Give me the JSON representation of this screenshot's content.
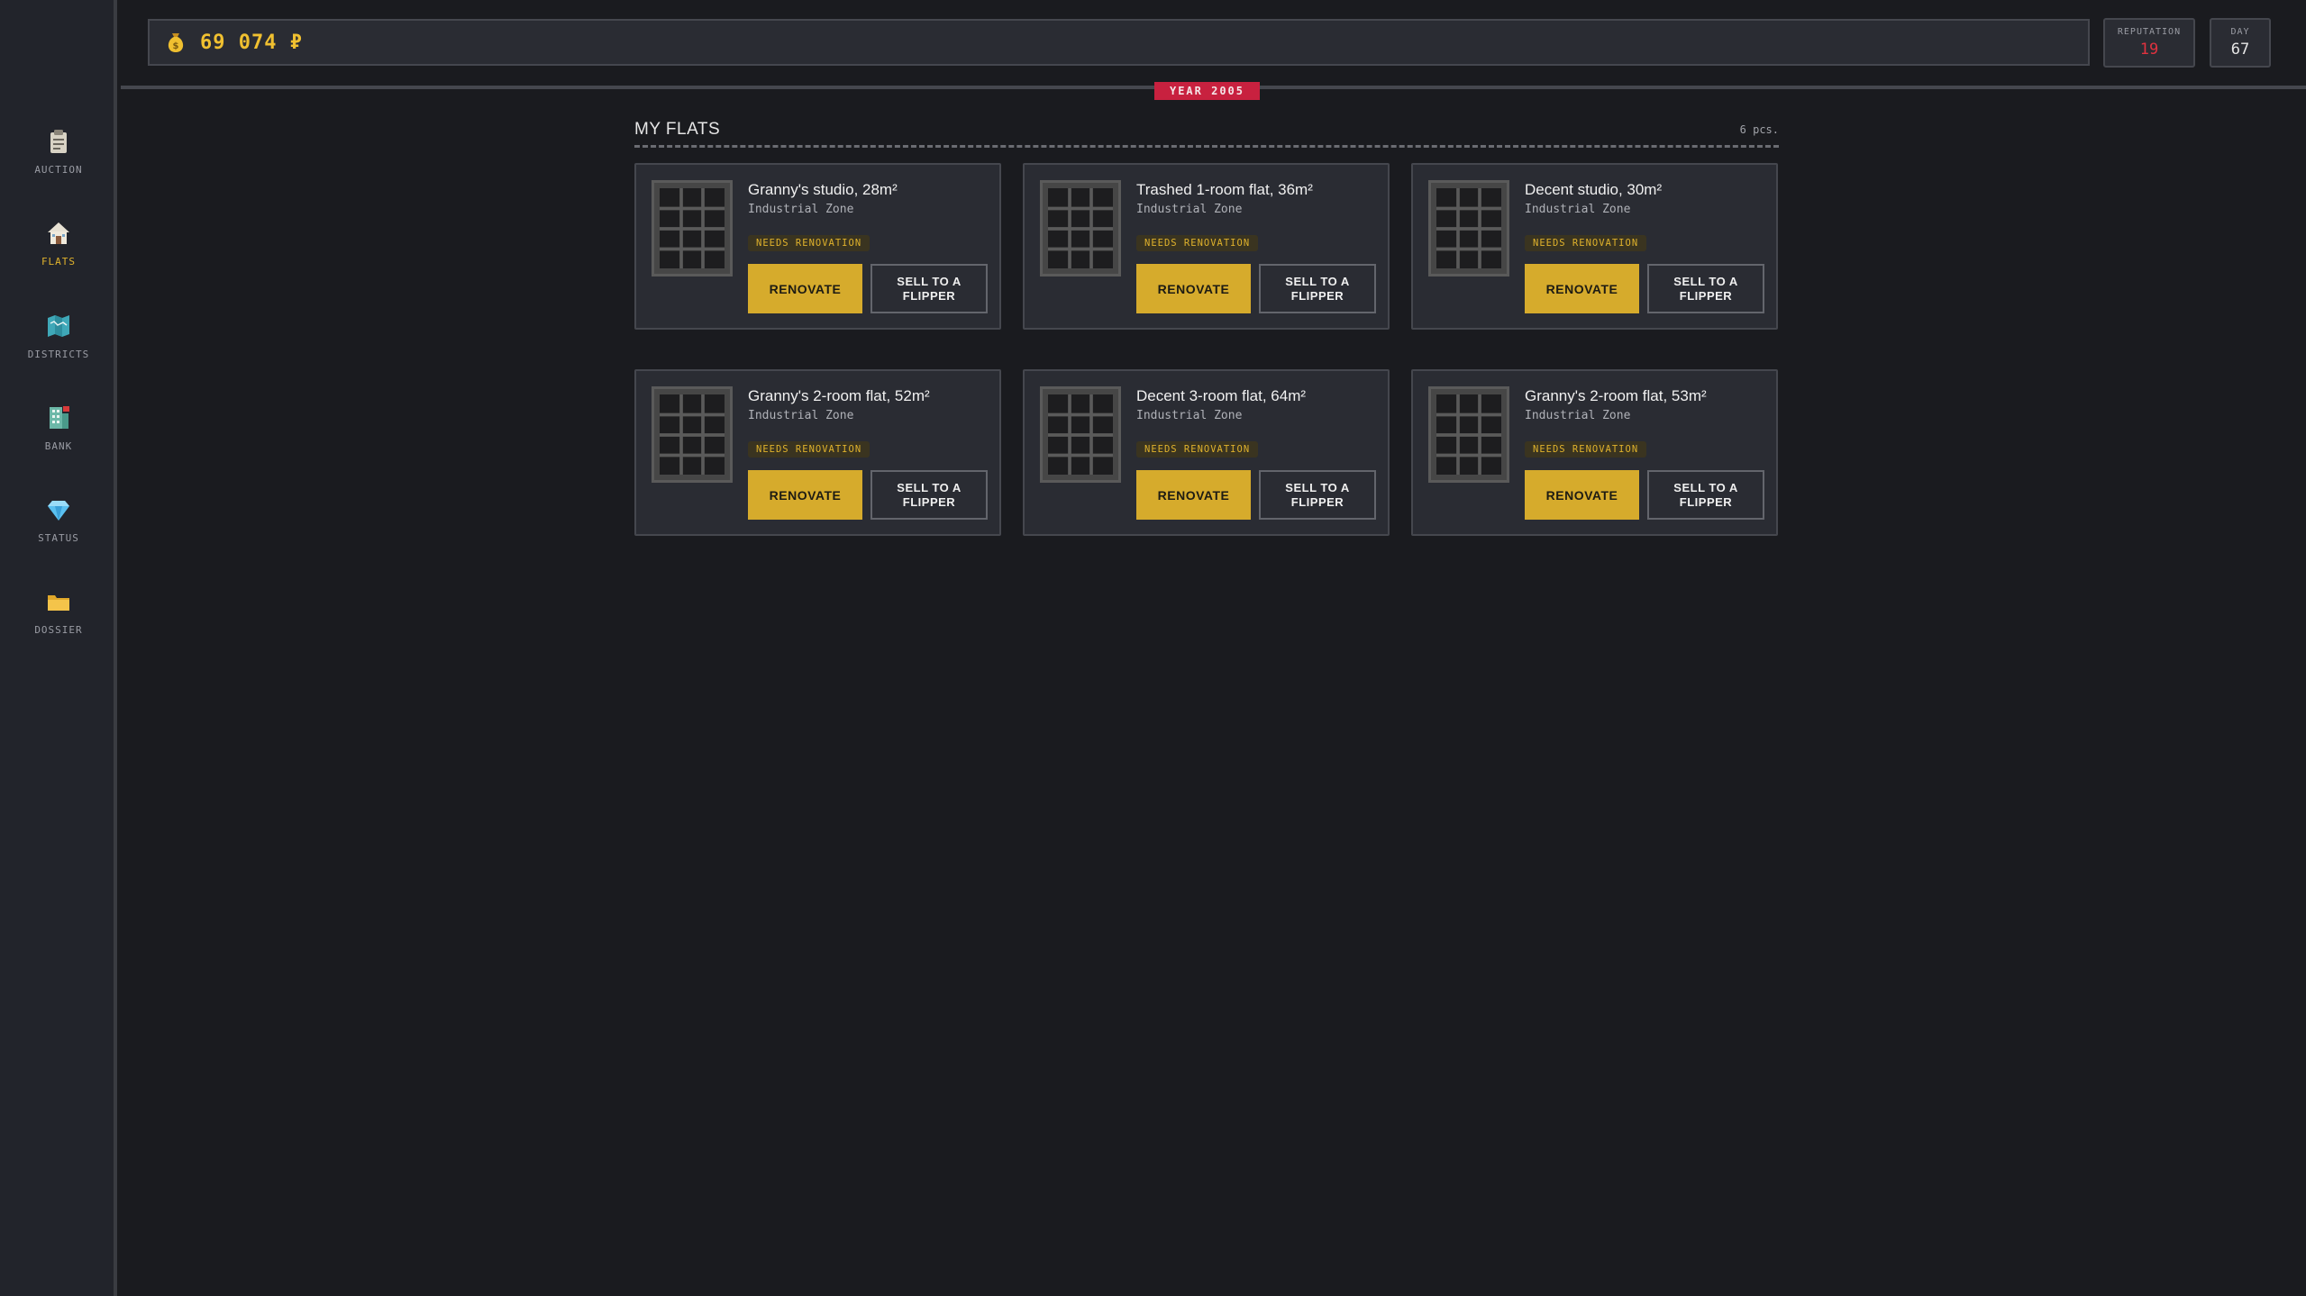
{
  "sidebar": {
    "items": [
      {
        "label": "AUCTION",
        "icon": "clipboard-icon"
      },
      {
        "label": "FLATS",
        "icon": "house-icon",
        "active": true
      },
      {
        "label": "DISTRICTS",
        "icon": "map-icon"
      },
      {
        "label": "BANK",
        "icon": "building-icon"
      },
      {
        "label": "STATUS",
        "icon": "diamond-icon"
      },
      {
        "label": "DOSSIER",
        "icon": "folder-icon"
      }
    ]
  },
  "header": {
    "money": "69 074 ₽",
    "money_icon": "money-bag-icon",
    "reputation_label": "REPUTATION",
    "reputation_value": "19",
    "day_label": "DAY",
    "day_value": "67",
    "year_badge": "YEAR 2005"
  },
  "flats": {
    "title": "MY FLATS",
    "count": "6 pcs.",
    "items": [
      {
        "title": "Granny's studio, 28m²",
        "district": "Industrial Zone",
        "badge": "NEEDS RENOVATION",
        "renovate": "RENOVATE",
        "sell": "SELL TO A FLIPPER"
      },
      {
        "title": "Trashed 1-room flat, 36m²",
        "district": "Industrial Zone",
        "badge": "NEEDS RENOVATION",
        "renovate": "RENOVATE",
        "sell": "SELL TO A FLIPPER"
      },
      {
        "title": "Decent studio, 30m²",
        "district": "Industrial Zone",
        "badge": "NEEDS RENOVATION",
        "renovate": "RENOVATE",
        "sell": "SELL TO A FLIPPER"
      },
      {
        "title": "Granny's 2-room flat, 52m²",
        "district": "Industrial Zone",
        "badge": "NEEDS RENOVATION",
        "renovate": "RENOVATE",
        "sell": "SELL TO A FLIPPER"
      },
      {
        "title": "Decent 3-room flat, 64m²",
        "district": "Industrial Zone",
        "badge": "NEEDS RENOVATION",
        "renovate": "RENOVATE",
        "sell": "SELL TO A FLIPPER"
      },
      {
        "title": "Granny's 2-room flat, 53m²",
        "district": "Industrial Zone",
        "badge": "NEEDS RENOVATION",
        "renovate": "RENOVATE",
        "sell": "SELL TO A FLIPPER"
      }
    ]
  },
  "colors": {
    "accent": "#d6ab2c",
    "reputation": "#e0323f",
    "year_badge": "#c8213f",
    "background": "#1a1b1f",
    "panel": "#2a2c33"
  }
}
